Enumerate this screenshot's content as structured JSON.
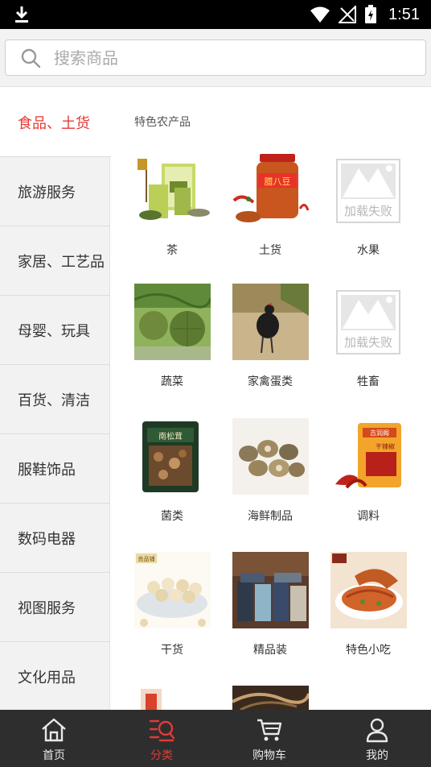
{
  "status_bar": {
    "time": "1:51"
  },
  "search": {
    "placeholder": "搜索商品"
  },
  "sidebar": {
    "items": [
      {
        "label": "食品、土货",
        "active": true
      },
      {
        "label": "旅游服务"
      },
      {
        "label": "家居、工艺品"
      },
      {
        "label": "母婴、玩具"
      },
      {
        "label": "百货、清洁"
      },
      {
        "label": "服鞋饰品"
      },
      {
        "label": "数码电器"
      },
      {
        "label": "视图服务"
      },
      {
        "label": "文化用品"
      }
    ]
  },
  "content": {
    "section_title": "特色农产品",
    "items": [
      {
        "label": "茶"
      },
      {
        "label": "土货"
      },
      {
        "label": "水果",
        "image_failed": true
      },
      {
        "label": "蔬菜"
      },
      {
        "label": "家禽蛋类"
      },
      {
        "label": "牲畜",
        "image_failed": true
      },
      {
        "label": "菌类"
      },
      {
        "label": "海鲜制品"
      },
      {
        "label": "调料"
      },
      {
        "label": "干货"
      },
      {
        "label": "精品装"
      },
      {
        "label": "特色小吃"
      }
    ],
    "load_failed_text": "加载失败",
    "product_texts": {
      "chili_jar": "腊八豆",
      "mushroom_bag": "南松茸",
      "spice_bag_brand": "吉润阁",
      "spice_bag_name": "干辣椒",
      "lotus_brand": "良品铺"
    }
  },
  "tabbar": {
    "tabs": [
      {
        "label": "首页",
        "icon": "home-icon"
      },
      {
        "label": "分类",
        "icon": "category-icon",
        "active": true
      },
      {
        "label": "购物车",
        "icon": "cart-icon"
      },
      {
        "label": "我的",
        "icon": "user-icon"
      }
    ]
  },
  "colors": {
    "accent": "#e53935",
    "tabbar_bg": "#2e2e2e",
    "sidebar_bg": "#f2f2f2"
  }
}
